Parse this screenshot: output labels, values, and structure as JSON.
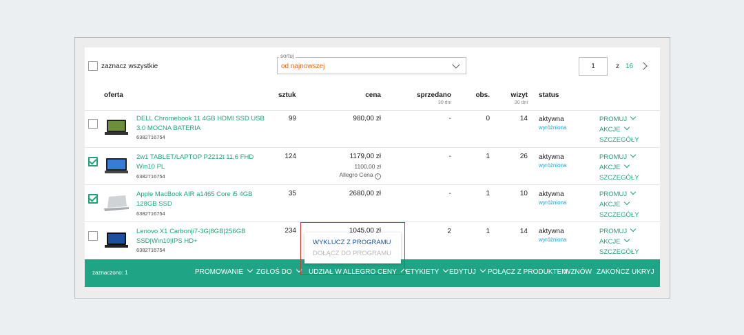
{
  "select_all": "zaznacz wszystkie",
  "sort": {
    "label": "sortuj",
    "value": "od najnowszej"
  },
  "pagination": {
    "current": "1",
    "of_label": "z",
    "total": "16"
  },
  "columns": {
    "offer": "oferta",
    "qty": "sztuk",
    "price": "cena",
    "sold": "sprzedano",
    "sold_sub": "30 dni",
    "watch": "obs.",
    "visits": "wizyt",
    "visits_sub": "30 dni",
    "status": "status"
  },
  "rows": [
    {
      "name": "DELL Chromebook 11 4GB HDMI SSD USB 3.0 MOCNA BATERIA",
      "id": "6382716754",
      "qty": "99",
      "price": "980,00 zł",
      "sold": "-",
      "watch": "0",
      "visits": "14",
      "status": "aktywna",
      "status_sub": "wyróżniona",
      "checked": false
    },
    {
      "name": "2w1 TABLET/LAPTOP P2212t 11,6 FHD Win10 PL",
      "id": "6382716754",
      "qty": "124",
      "price": "1179,00 zł",
      "price_old": "1100,00 zł",
      "price_note": "Allegro Cena",
      "sold": "-",
      "watch": "1",
      "visits": "26",
      "status": "aktywna",
      "status_sub": "wyróżniona",
      "checked": true
    },
    {
      "name": "Apple MacBook AIR a1465 Core i5 4GB 128GB SSD",
      "id": "6382716754",
      "qty": "35",
      "price": "2680,00 zł",
      "sold": "-",
      "watch": "1",
      "visits": "10",
      "status": "aktywna",
      "status_sub": "wyróżniona",
      "checked": true
    },
    {
      "name": "Lenovo X1 Carbon|i7-3G|8GB|256GB SSD|Win10|IPS HD+",
      "id": "6382716754",
      "qty": "234",
      "price": "1045,00 zł",
      "sold": "2",
      "watch": "1",
      "visits": "14",
      "status": "aktywna",
      "status_sub": "wyróżniona",
      "checked": false
    }
  ],
  "row_actions": {
    "promote": "PROMUJ",
    "actions": "AKCJE",
    "details": "SZCZEGÓŁY"
  },
  "bottom_bar": {
    "selected": "zaznaczono: 1",
    "items": [
      "PROMOWANIE",
      "ZGŁOŚ DO",
      "UDZIAŁ W ALLEGRO CENY",
      "ETYKIETY",
      "EDYTUJ",
      "POŁĄCZ Z PRODUKTEM",
      "WZNÓW",
      "ZAKOŃCZ",
      "UKRYJ"
    ]
  },
  "dropdown": {
    "exclude": "WYKLUCZ Z PROGRAMU",
    "join": "DOŁĄCZ DO PROGRAMU"
  },
  "colors": {
    "accent": "#1fa575",
    "orange": "#e8690f",
    "highlight": "#d9322a",
    "link": "#1e9fd0"
  },
  "icons": [
    "chevron-down-icon",
    "chevron-right-icon",
    "chevron-up-icon",
    "checkbox-icon",
    "info-icon",
    "laptop-icon"
  ]
}
